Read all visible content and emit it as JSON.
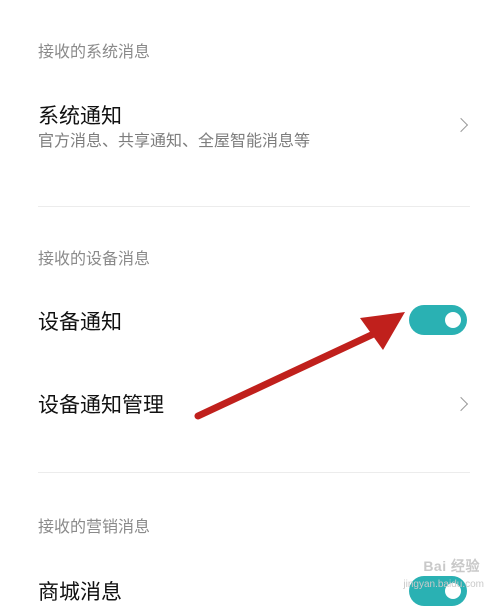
{
  "sections": {
    "system": {
      "header": "接收的系统消息",
      "item_title": "系统通知",
      "item_subtitle": "官方消息、共享通知、全屋智能消息等"
    },
    "device": {
      "header": "接收的设备消息",
      "notify_title": "设备通知",
      "notify_toggle_on": true,
      "manage_title": "设备通知管理"
    },
    "marketing": {
      "header": "接收的营销消息",
      "store_title": "商城消息",
      "store_toggle_on": true
    }
  },
  "colors": {
    "toggle_on": "#2ab1b3",
    "arrow": "#c0201c"
  },
  "icons": {
    "chevron": "chevron-right-icon"
  },
  "watermark": {
    "text": "Bai 经验",
    "url": "jingyan.baidu.com"
  }
}
